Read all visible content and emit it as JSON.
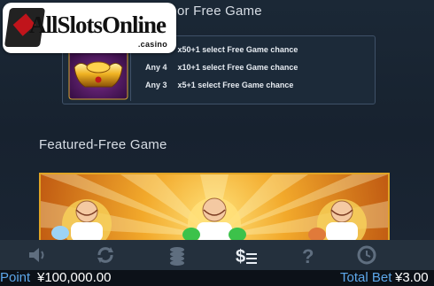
{
  "logo": {
    "brand": "AllSlotsOnline",
    "sub": ".casino"
  },
  "free_game": {
    "title": "or Free Game",
    "rows": [
      {
        "any": "",
        "text": "x50+1 select Free Game chance"
      },
      {
        "any": "Any 4",
        "text": "x10+1 select Free Game chance"
      },
      {
        "any": "Any 3",
        "text": "x5+1 select Free Game chance"
      }
    ]
  },
  "featured": {
    "title": "Featured-Free Game"
  },
  "toolbar": {
    "icons": [
      "speaker-icon",
      "autoplay-icon",
      "coins-icon",
      "paytable-icon",
      "help-icon",
      "history-icon"
    ]
  },
  "status": {
    "point_label": "Point",
    "point_value": "¥100,000.00",
    "bet_label": "Total Bet",
    "bet_value": "¥3.00"
  },
  "colors": {
    "accent": "#5da7ea",
    "gold": "#e0a425",
    "background": "#16212e"
  }
}
